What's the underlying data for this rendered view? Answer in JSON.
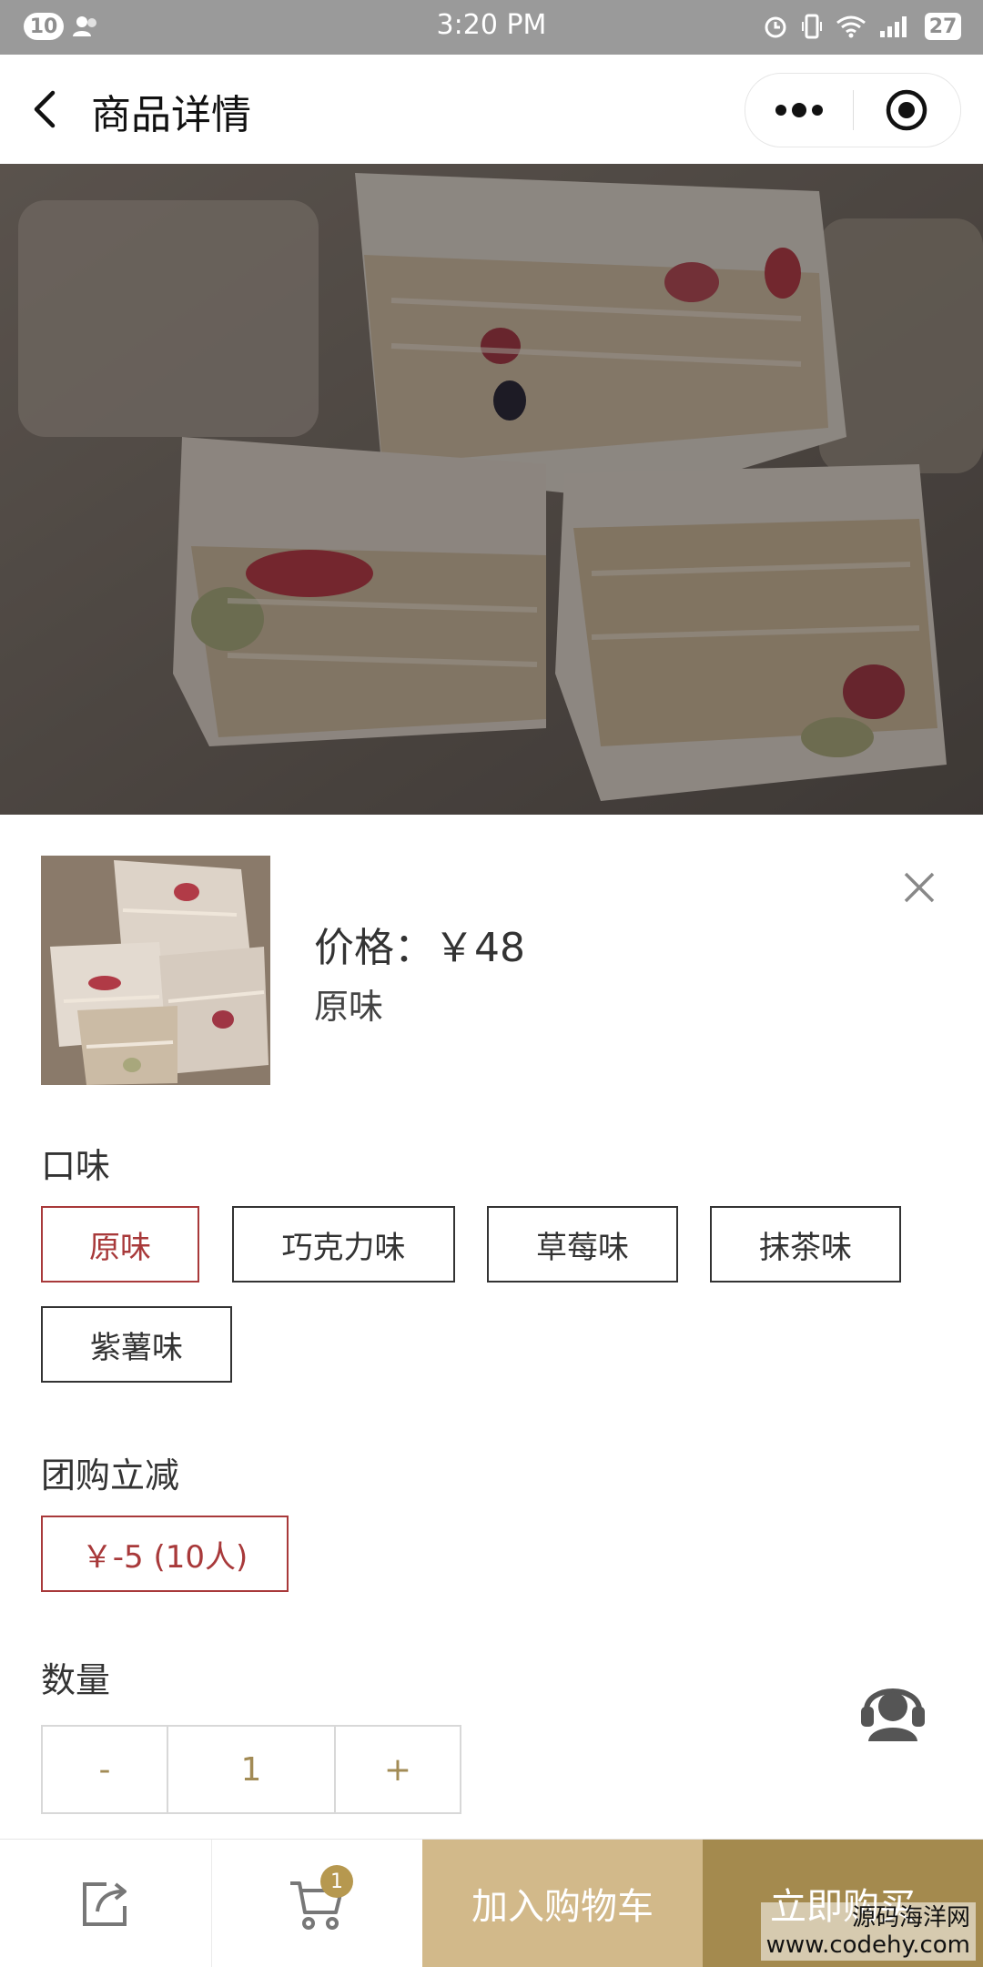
{
  "status_bar": {
    "notification_count": "10",
    "time": "3:20 PM",
    "battery": "27"
  },
  "nav": {
    "title": "商品详情"
  },
  "sheet": {
    "price": "价格：￥48",
    "selected_variant": "原味",
    "flavor_title": "口味",
    "flavors": [
      {
        "label": "原味",
        "selected": true
      },
      {
        "label": "巧克力味",
        "selected": false
      },
      {
        "label": "草莓味",
        "selected": false
      },
      {
        "label": "抹茶味",
        "selected": false
      },
      {
        "label": "紫薯味",
        "selected": false
      }
    ],
    "group_title": "团购立减",
    "group_option": "￥-5 (10人)",
    "quantity_title": "数量",
    "quantity": {
      "minus": "-",
      "value": "1",
      "plus": "+"
    }
  },
  "action_bar": {
    "cart_count": "1",
    "add_to_cart": "加入购物车",
    "buy_now": "立即购买"
  },
  "watermark": {
    "line1": "源码海洋网",
    "line2": "www.codehy.com"
  },
  "colors": {
    "selected_border": "#a8393a",
    "add_to_cart_bg": "#d2b98a",
    "buy_now_bg": "#a48a4e",
    "qty_text": "#a28b55"
  }
}
